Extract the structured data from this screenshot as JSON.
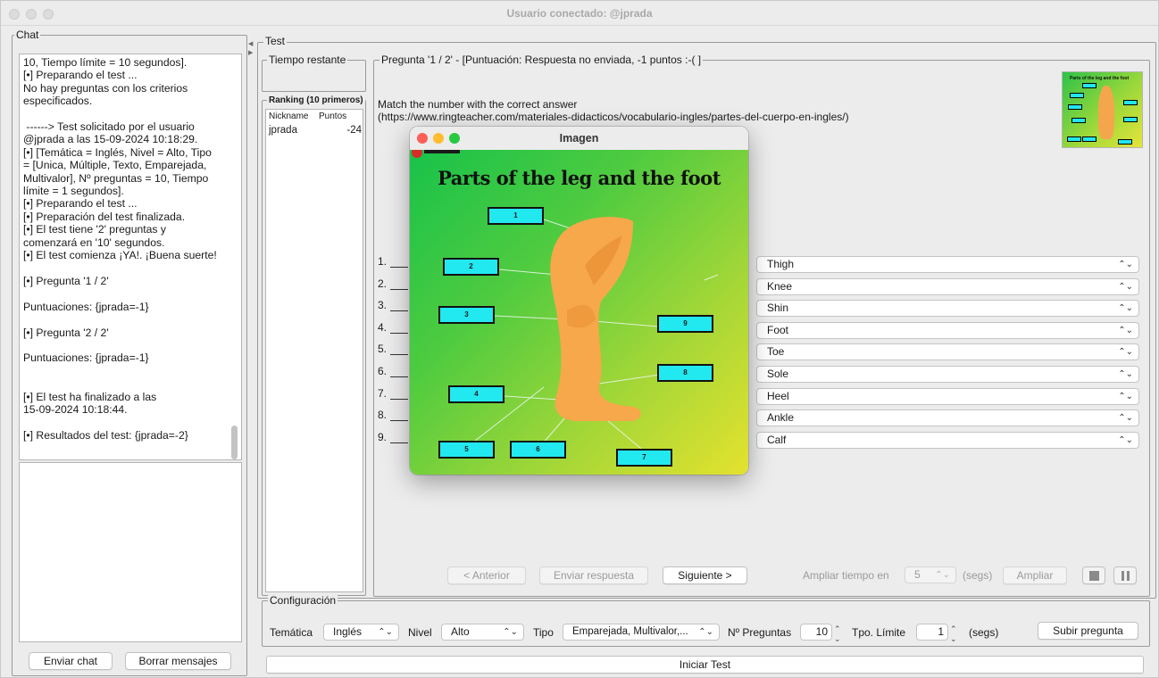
{
  "window": {
    "title": "Usuario conectado: @jprada"
  },
  "chat": {
    "legend": "Chat",
    "messages": "10, Tiempo límite = 10 segundos].\n[•] Preparando el test ...\nNo hay preguntas con los criterios\nespecificados.\n\n ------> Test solicitado por el usuario\n@jprada a las 15-09-2024 10:18:29.\n[•] [Temática = Inglés, Nivel = Alto, Tipo\n= [Unica, Múltiple, Texto, Emparejada,\nMultivalor], Nº preguntas = 10, Tiempo\nlímite = 1 segundos].\n[•] Preparando el test ...\n[•] Preparación del test finalizada.\n[•] El test tiene '2' preguntas y\ncomenzará en '10' segundos.\n[•] El test comienza ¡YA!. ¡Buena suerte!\n\n[•] Pregunta '1 / 2'\n\nPuntuaciones: {jprada=-1}\n\n[•] Pregunta '2 / 2'\n\nPuntuaciones: {jprada=-1}\n\n\n[•] El test ha finalizado a las\n15-09-2024 10:18:44.\n\n[•] Resultados del test: {jprada=-2}",
    "send_label": "Enviar chat",
    "clear_label": "Borrar mensajes"
  },
  "test": {
    "legend": "Test",
    "time_legend": "Tiempo restante",
    "ranking_legend": "Ranking (10 primeros)",
    "ranking_columns": [
      "Nickname",
      "Puntos"
    ],
    "ranking_rows": [
      {
        "nickname": "jprada",
        "points": "-24"
      }
    ],
    "question_legend": "Pregunta '1 / 2' - [Puntuación: Respuesta no enviada, -1 puntos :-( ]",
    "question_line1": "Match the number with the correct answer",
    "question_line2": "(https://www.ringteacher.com/materiales-didacticos/vocabulario-ingles/partes-del-cuerpo-en-ingles/)",
    "numbers": [
      "1.",
      "2.",
      "3.",
      "4.",
      "5.",
      "6.",
      "7.",
      "8.",
      "9."
    ],
    "answers": [
      "Thigh",
      "Knee",
      "Shin",
      "Foot",
      "Toe",
      "Sole",
      "Heel",
      "Ankle",
      "Calf"
    ],
    "prev_label": "< Anterior",
    "send_answer_label": "Enviar respuesta",
    "next_label": "Siguiente >",
    "extend_label": "Ampliar tiempo en",
    "extend_value": "5",
    "extend_unit": "(segs)",
    "extend_button": "Ampliar"
  },
  "thumbnail": {
    "title": "Parts of the leg and the foot"
  },
  "image_dialog": {
    "title": "Imagen",
    "image_title": "Parts of the leg and the foot",
    "box_numbers": [
      "1",
      "2",
      "3",
      "4",
      "5",
      "6",
      "7",
      "8",
      "9"
    ]
  },
  "config": {
    "legend": "Configuración",
    "topic_label": "Temática",
    "topic_value": "Inglés",
    "level_label": "Nivel",
    "level_value": "Alto",
    "type_label": "Tipo",
    "type_value": "Emparejada, Multivalor,...",
    "num_questions_label": "Nº Preguntas",
    "num_questions_value": "10",
    "time_limit_label": "Tpo. Límite",
    "time_limit_value": "1",
    "time_unit": "(segs)",
    "upload_label": "Subir pregunta",
    "start_label": "Iniciar Test"
  }
}
